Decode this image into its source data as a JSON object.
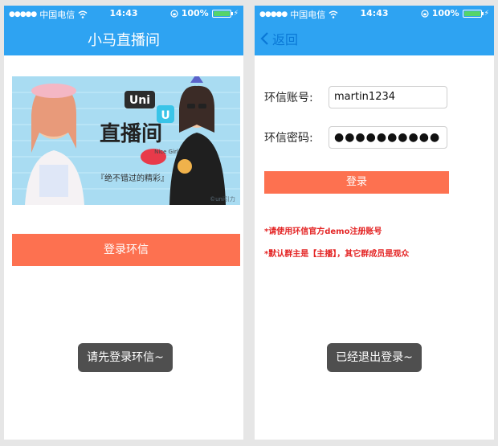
{
  "status_bar": {
    "signal_dots": "●●●●●",
    "carrier": "中国电信",
    "time": "14:43",
    "battery_percent": "100%",
    "battery_level": 1.0
  },
  "left_screen": {
    "title": "小马直播间",
    "banner": {
      "brand_text": "Uni",
      "headline": "直播间",
      "tagline": "『绝不错过的精彩』",
      "badge": "Nice Girl",
      "watermark": "©uni引力"
    },
    "login_button_label": "登录环信",
    "toast": "请先登录环信~"
  },
  "right_screen": {
    "back_label": "返回",
    "account_label": "环信账号:",
    "account_value": "martin1234",
    "password_label": "环信密码:",
    "password_mask": "●●●●●●●●●●",
    "login_button_label": "登录",
    "note_1": "*请使用环信官方demo注册账号",
    "note_2": "*默认群主是【主播】，其它群成员是观众",
    "toast": "已经退出登录~"
  },
  "colors": {
    "nav": "#2ea3f2",
    "button": "#fd7150",
    "warning": "#e42424"
  }
}
